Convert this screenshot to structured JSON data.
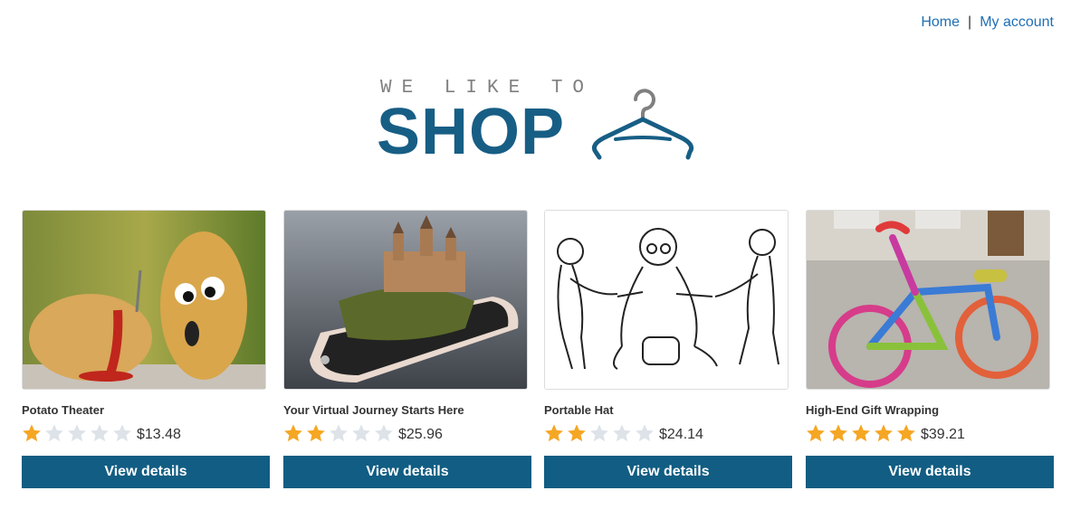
{
  "nav": {
    "home": "Home",
    "separator": "|",
    "account": "My account"
  },
  "logo": {
    "tagline": "WE LIKE TO",
    "word": "SHOP",
    "icon": "hanger-icon"
  },
  "colors": {
    "brand": "#175e85",
    "button": "#115d83",
    "star_on": "#f5a623",
    "star_off": "#dde3e8",
    "link": "#1e6fb5"
  },
  "products": [
    {
      "title": "Potato Theater",
      "rating": 1,
      "max_rating": 5,
      "price": "$13.48",
      "button": "View details",
      "image": "potatoes-photo"
    },
    {
      "title": "Your Virtual Journey Starts Here",
      "rating": 2,
      "max_rating": 5,
      "price": "$25.96",
      "button": "View details",
      "image": "castle-phone-photo"
    },
    {
      "title": "Portable Hat",
      "rating": 2,
      "max_rating": 5,
      "price": "$24.14",
      "button": "View details",
      "image": "sketch-drawing"
    },
    {
      "title": "High-End Gift Wrapping",
      "rating": 5,
      "max_rating": 5,
      "price": "$39.21",
      "button": "View details",
      "image": "knitted-bicycle-photo"
    }
  ]
}
